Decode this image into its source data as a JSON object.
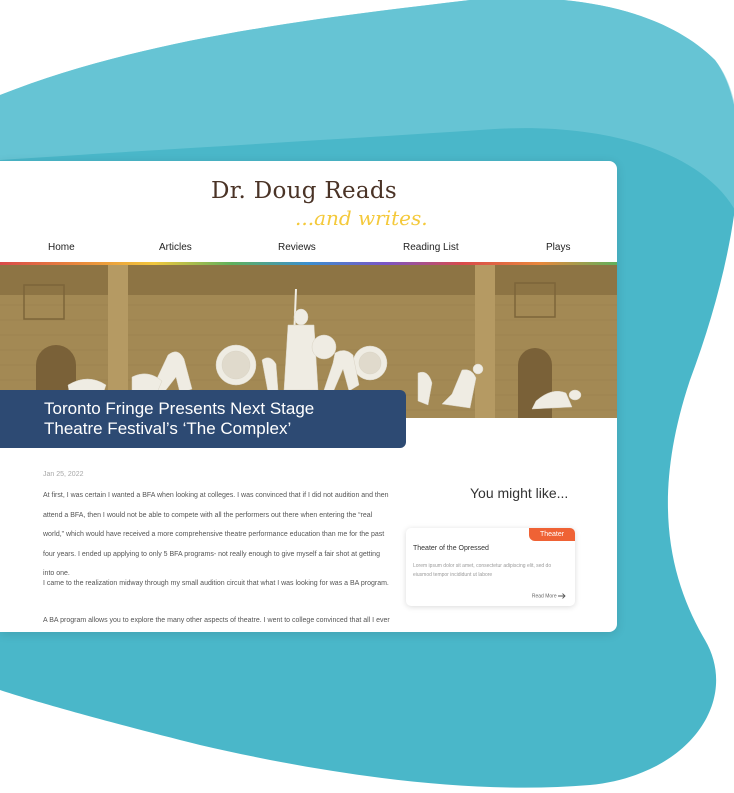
{
  "brand": {
    "title": "Dr. Doug Reads",
    "subtitle": "...and writes."
  },
  "nav": {
    "items": [
      "Home",
      "Articles",
      "Reviews",
      "Reading List",
      "Plays"
    ]
  },
  "article": {
    "title_line1": "Toronto Fringe Presents Next Stage",
    "title_line2": "Theatre Festival’s ‘The Complex’",
    "date": "Jan 25, 2022",
    "paragraphs": [
      "At first, I was certain I wanted a BFA when looking at colleges. I was convinced that if I did not audition and then attend a BFA, then I would not be able to compete with all the performers out there when entering the “real world,” which would have received a more comprehensive theatre performance education than me for the past four years. I ended up applying to only 5 BFA programs- not really enough to give myself a fair shot at getting into one.",
      "I came to the realization midway through my small audition circuit that what I was looking for was a BA program.",
      "A BA program allows you to explore the many other aspects of theatre. I went to college convinced that all I ever"
    ]
  },
  "aside": {
    "title": "You might like...",
    "card": {
      "badge": "Theater",
      "title": "Theater of the Opressed",
      "description": "Lorem ipsum dolor sit amet, consectetur adipiscing elit, sed do eiusmod tempor incididunt ut labore",
      "link": "Read More"
    }
  },
  "colors": {
    "blob": "#4ab7c9",
    "banner": "#2d4a73",
    "badge": "#ef6235",
    "brand_text": "#4a3326",
    "brand_accent": "#f4c93b",
    "hero_tint": "#a38954"
  },
  "icons": {
    "read_more": "arrow-right-icon"
  }
}
